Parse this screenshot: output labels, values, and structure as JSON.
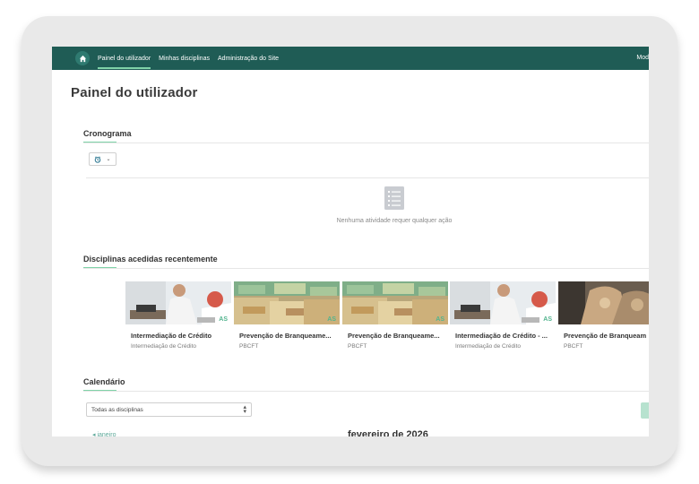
{
  "navbar": {
    "items": [
      "Painel do utilizador",
      "Minhas disciplinas",
      "Administração do Site"
    ],
    "right_label": "Mod"
  },
  "page": {
    "title": "Painel do utilizador"
  },
  "timeline": {
    "title": "Cronograma",
    "empty_text": "Nenhuma atividade requer qualquer ação"
  },
  "recent_courses": {
    "title": "Disciplinas acedidas recentemente",
    "badge": "AS",
    "courses": [
      {
        "name": "Intermediação de Crédito",
        "category": "Intermediação de Crédito",
        "image": "office"
      },
      {
        "name": "Prevenção de Branqueame...",
        "category": "PBCFT",
        "image": "money"
      },
      {
        "name": "Prevenção de Branqueame...",
        "category": "PBCFT",
        "image": "money"
      },
      {
        "name": "Intermediação de Crédito - ...",
        "category": "Intermediação de Crédito",
        "image": "office"
      },
      {
        "name": "Prevenção de Branqueam",
        "category": "PBCFT",
        "image": "bags"
      }
    ]
  },
  "calendar": {
    "title": "Calendário",
    "filter_value": "Todas as disciplinas",
    "prev_month": "janeiro",
    "current_month": "fevereiro de 2026"
  },
  "colors": {
    "navbar": "#1f5c55",
    "accent": "#7fd3a8"
  }
}
